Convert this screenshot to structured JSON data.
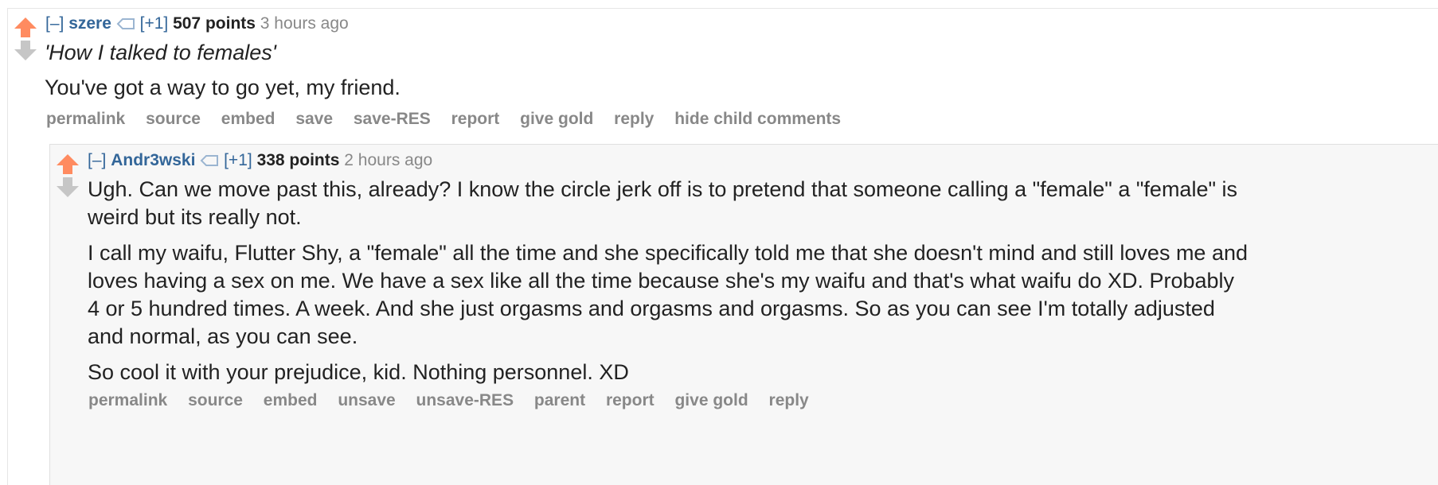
{
  "colors": {
    "upvote": "#ff8b60",
    "downvote": "#c6c6c6",
    "author": "#336699",
    "meta": "#888888"
  },
  "parent_comment": {
    "collapse": "[–]",
    "author": "szere",
    "tag_icon": "tag-icon",
    "plus_one": "[+1]",
    "score": "507 points",
    "time": "3 hours ago",
    "quote": "'How I talked to females'",
    "text": "You've got a way to go yet, my friend.",
    "buttons": [
      "permalink",
      "source",
      "embed",
      "save",
      "save-RES",
      "report",
      "give gold",
      "reply",
      "hide child comments"
    ]
  },
  "child_comment": {
    "collapse": "[–]",
    "author": "Andr3wski",
    "tag_icon": "tag-icon",
    "plus_one": "[+1]",
    "score": "338 points",
    "time": "2 hours ago",
    "paragraphs": [
      "Ugh. Can we move past this, already? I know the circle jerk off is to pretend that someone calling a \"female\" a \"female\" is weird but its really not.",
      "I call my waifu, Flutter Shy, a \"female\" all the time and she specifically told me that she doesn't mind and still loves me and loves having a sex on me. We have a sex like all the time because she's my waifu and that's what waifu do XD. Probably 4 or 5 hundred times. A week. And she just orgasms and orgasms and orgasms. So as you can see I'm totally adjusted and normal, as you can see.",
      "So cool it with your prejudice, kid. Nothing personnel. XD"
    ],
    "buttons": [
      "permalink",
      "source",
      "embed",
      "unsave",
      "unsave-RES",
      "parent",
      "report",
      "give gold",
      "reply"
    ]
  }
}
